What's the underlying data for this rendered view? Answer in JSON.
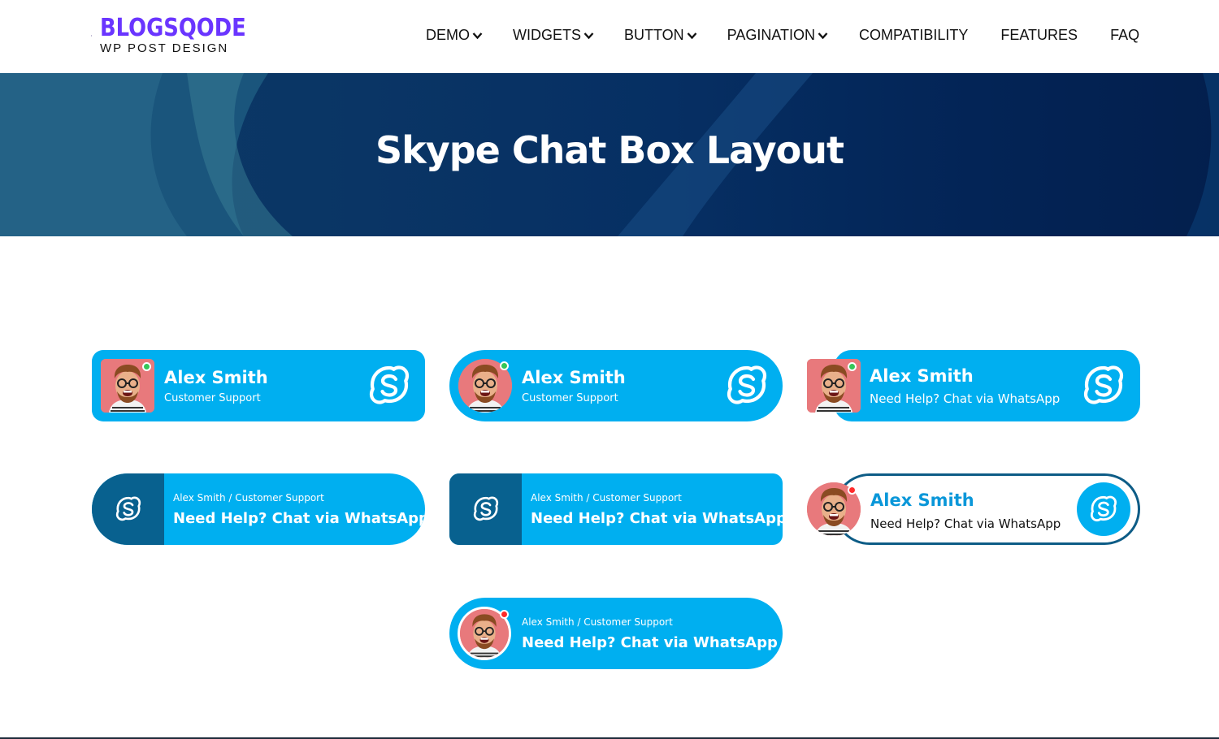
{
  "brand": {
    "name": "BLOGSQODE",
    "subtitle": "WP POST DESIGN",
    "accent": "#6a35ff"
  },
  "nav": {
    "items": [
      {
        "label": "DEMO",
        "dropdown": true
      },
      {
        "label": "WIDGETS",
        "dropdown": true
      },
      {
        "label": "BUTTON",
        "dropdown": true
      },
      {
        "label": "PAGINATION",
        "dropdown": true
      },
      {
        "label": "COMPATIBILITY",
        "dropdown": false
      },
      {
        "label": "FEATURES",
        "dropdown": false
      },
      {
        "label": "FAQ",
        "dropdown": false
      }
    ]
  },
  "banner": {
    "title": "Skype Chat Box Layout"
  },
  "colors": {
    "skype_blue": "#00aff0",
    "dark_blue": "#08618f",
    "online": "#35c759",
    "busy": "#ff2a2a"
  },
  "boxes": [
    {
      "style": "rounded-square-avatar",
      "name": "Alex Smith",
      "subtitle": "Customer Support",
      "status": "online",
      "icon": "skype-icon"
    },
    {
      "style": "pill-round-avatar",
      "name": "Alex Smith",
      "subtitle": "Customer Support",
      "status": "online",
      "icon": "skype-icon"
    },
    {
      "style": "overlap-avatar",
      "name": "Alex Smith",
      "subtitle": "Need Help? Chat via WhatsApp",
      "status": "online",
      "icon": "skype-icon"
    },
    {
      "style": "dark-icon-pill",
      "top": "Alex Smith / Customer Support",
      "bottom": "Need Help? Chat via WhatsApp",
      "icon": "skype-icon"
    },
    {
      "style": "dark-icon-square",
      "top": "Alex Smith / Customer Support",
      "bottom": "Need Help? Chat via WhatsApp",
      "icon": "skype-icon"
    },
    {
      "style": "outline-white",
      "name": "Alex Smith",
      "subtitle": "Need Help? Chat via WhatsApp",
      "status": "busy",
      "icon": "skype-icon"
    },
    {
      "style": "pill-avatar-busy",
      "top": "Alex Smith / Customer Support",
      "bottom": "Need Help? Chat via WhatsApp",
      "status": "busy"
    }
  ]
}
